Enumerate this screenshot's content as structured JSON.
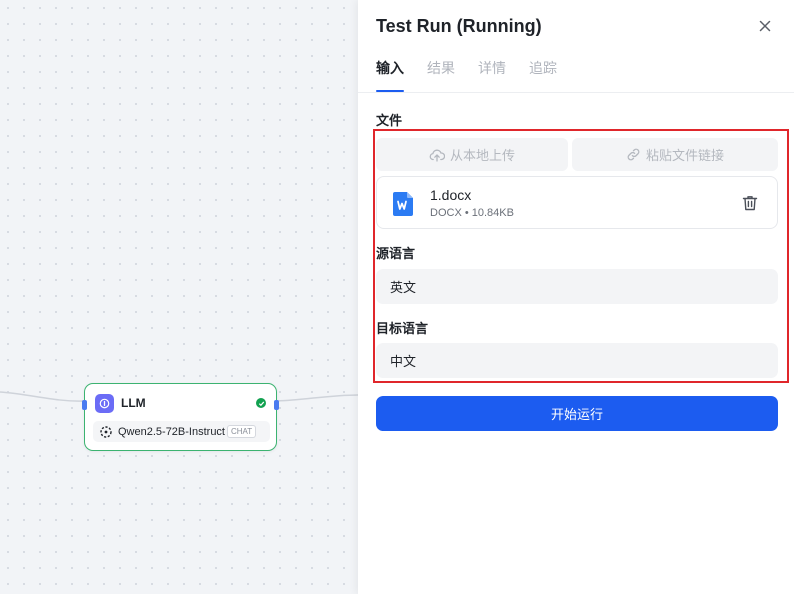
{
  "canvas": {
    "node": {
      "title": "LLM",
      "model_name": "Qwen2.5-72B-Instruct",
      "model_tag": "CHAT",
      "status_color": "#12a150",
      "icon": "llm-node-icon"
    }
  },
  "panel": {
    "title": "Test Run (Running)",
    "tabs": [
      {
        "label": "输入",
        "active": true
      },
      {
        "label": "结果",
        "active": false
      },
      {
        "label": "详情",
        "active": false
      },
      {
        "label": "追踪",
        "active": false
      }
    ],
    "file_section": {
      "label": "文件",
      "upload_local_label": "从本地上传",
      "paste_link_label": "粘贴文件链接",
      "file": {
        "name": "1.docx",
        "meta": "DOCX • 10.84KB",
        "icon": "word-doc-icon"
      }
    },
    "source_language": {
      "label": "源语言",
      "value": "英文"
    },
    "target_language": {
      "label": "目标语言",
      "value": "中文"
    },
    "run_button_label": "开始运行",
    "colors": {
      "accent": "#1c5cf0",
      "highlight_border": "#e0262b",
      "node_border": "#3cb371"
    }
  }
}
